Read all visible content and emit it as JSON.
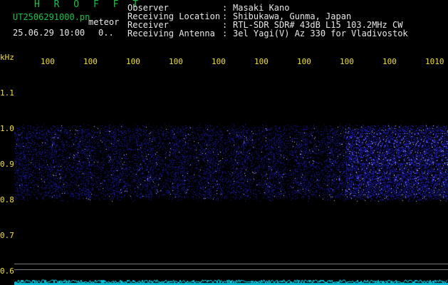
{
  "header": {
    "title": "H R O F F T",
    "file_name": "UT2506291000.pn",
    "tag": "meteor",
    "date_time": "25.06.29 10:00",
    "counter": "0.."
  },
  "metadata": [
    {
      "label": "Observer",
      "value": "Masaki Kano"
    },
    {
      "label": "Receiving Location",
      "value": "Shibukawa, Gunma, Japan"
    },
    {
      "label": "Receiver",
      "value": "RTL-SDR SDR# 43dB L15 103.2MHz CW"
    },
    {
      "label": "Receiving Antenna",
      "value": "3el Yagi(V) Az 330 for Vladivostok"
    }
  ],
  "separator": ":",
  "axis": {
    "unit": "kHz",
    "y_ticks": [
      "1.1",
      "1.0",
      "0.9",
      "0.8",
      "0.7",
      "0.6"
    ],
    "x_ticks": [
      "100",
      "100",
      "100",
      "100",
      "100",
      "100",
      "100",
      "100",
      "100",
      "1010"
    ]
  },
  "colors": {
    "signal": "#1a1aff",
    "noise_floor": "#00e5ff",
    "label_yellow": "#f0e030",
    "label_green": "#17c24a",
    "grid_line": "#7a7a7a"
  }
}
